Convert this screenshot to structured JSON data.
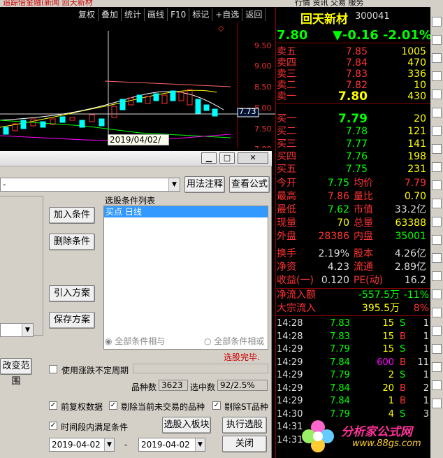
{
  "top": {
    "left_text": "追踪借金融(新闻 回天新材",
    "right_text": "行情 资讯 交易 服务"
  },
  "toolbar": [
    "复权",
    "叠加",
    "统计",
    "画线",
    "F10",
    "标记",
    "+自选",
    "返回"
  ],
  "chart": {
    "yticks": [
      "9.50",
      "9.00",
      "8.50",
      "8.00",
      "7.73",
      "7.50",
      "7.00"
    ],
    "date_label": "2019/04/02/二"
  },
  "stock": {
    "name": "回天新材",
    "code": "300041",
    "price": "7.80",
    "change": "▼-0.16",
    "pct": "-2.01%"
  },
  "sell": [
    {
      "label": "卖五",
      "price": "7.85",
      "vol": "1005"
    },
    {
      "label": "卖四",
      "price": "7.84",
      "vol": "470"
    },
    {
      "label": "卖三",
      "price": "7.83",
      "vol": "336"
    },
    {
      "label": "卖二",
      "price": "7.82",
      "vol": "10"
    },
    {
      "label": "卖一",
      "price": "7.80",
      "vol": "430"
    }
  ],
  "buy": [
    {
      "label": "买一",
      "price": "7.79",
      "vol": "20"
    },
    {
      "label": "买二",
      "price": "7.78",
      "vol": "121"
    },
    {
      "label": "买三",
      "price": "7.77",
      "vol": "141"
    },
    {
      "label": "买四",
      "price": "7.76",
      "vol": "198"
    },
    {
      "label": "买五",
      "price": "7.75",
      "vol": "231"
    }
  ],
  "stats": [
    {
      "l1": "今开",
      "v1": "7.75",
      "l2": "均价",
      "v2": "7.79",
      "c1": "grn",
      "c2": "red"
    },
    {
      "l1": "最高",
      "v1": "7.86",
      "l2": "量比",
      "v2": "0.70",
      "c1": "red",
      "c2": "yel"
    },
    {
      "l1": "最低",
      "v1": "7.62",
      "l2": "市值",
      "v2": "33.2亿",
      "c1": "grn",
      "c2": "wht"
    },
    {
      "l1": "现量",
      "v1": "70",
      "l2": "总量",
      "v2": "63388",
      "c1": "yel",
      "c2": "yel"
    },
    {
      "l1": "外盘",
      "v1": "28386",
      "l2": "内盘",
      "v2": "35001",
      "c1": "red",
      "c2": "grn"
    },
    {
      "l1": "换手",
      "v1": "2.19%",
      "l2": "股本",
      "v2": "4.26亿",
      "c1": "wht",
      "c2": "wht"
    },
    {
      "l1": "净资",
      "v1": "4.23",
      "l2": "流通",
      "v2": "2.89亿",
      "c1": "wht",
      "c2": "wht"
    },
    {
      "l1": "收益(一)",
      "v1": "0.120",
      "l2": "PE(动)",
      "v2": "16.2",
      "c1": "wht",
      "c2": "wht"
    }
  ],
  "flow": [
    {
      "label": "净流入额",
      "v": "-557.5万",
      "p": "-11%"
    },
    {
      "label": "大宗流入",
      "v": "395.5万",
      "p": "8%"
    }
  ],
  "ticks": [
    {
      "t": "14:28",
      "p": "7.83",
      "v": "15",
      "s": "S",
      "n": "1"
    },
    {
      "t": "14:28",
      "p": "7.83",
      "v": "15",
      "s": "B",
      "n": "1"
    },
    {
      "t": "14:29",
      "p": "7.79",
      "v": "15",
      "s": "S",
      "n": "1"
    },
    {
      "t": "14:29",
      "p": "7.84",
      "v": "600",
      "s": "B",
      "n": "11"
    },
    {
      "t": "14:29",
      "p": "7.79",
      "v": "2",
      "s": "S",
      "n": "1"
    },
    {
      "t": "14:29",
      "p": "7.84",
      "v": "20",
      "s": "B",
      "n": "2"
    },
    {
      "t": "14:29",
      "p": "7.84",
      "v": "1",
      "s": "B",
      "n": "1"
    },
    {
      "t": "14:30",
      "p": "7.79",
      "v": "4",
      "s": "S",
      "n": "3"
    },
    {
      "t": "14:31",
      "p": "",
      "v": "",
      "s": "",
      "n": ""
    },
    {
      "t": "14:31",
      "p": "",
      "v": "",
      "s": "",
      "n": ""
    }
  ],
  "dialog": {
    "formula_value": "-",
    "usage_btn": "用法注释",
    "view_btn": "查看公式",
    "list_title": "选股条件列表",
    "list_item": "买点  日线",
    "add_btn": "加入条件",
    "del_btn": "删除条件",
    "import_btn": "引入方案",
    "save_btn": "保存方案",
    "range_btn": "改变范围",
    "radio1": "全部条件相与",
    "radio2": "全部条件相或",
    "status": "选股完毕.",
    "chk_period": "使用涨跌不定周期",
    "count_label": "品种数",
    "count_val": "3623",
    "sel_label": "选中数",
    "sel_val": "92/2.5%",
    "chk1": "前复权数据",
    "chk2": "剔除当前未交易的品种",
    "chk3": "剔除ST品种",
    "chk4": "时间段内满足条件",
    "to_block_btn": "选股入板块",
    "run_btn": "执行选股",
    "date_from": "2019-04-02",
    "date_to": "2019-04-02",
    "dash": "-",
    "close_btn": "关闭"
  },
  "logo": {
    "text": "分析家公式网",
    "url": "www.88gs.com"
  }
}
